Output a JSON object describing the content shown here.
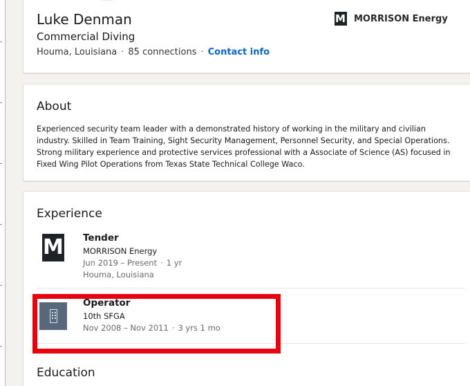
{
  "profile": {
    "name": "Luke Denman",
    "headline": "Commercial Diving",
    "location": "Houma, Louisiana",
    "connections": "85 connections",
    "contact_link": "Contact info",
    "current_company": {
      "name": "MORRISON Energy",
      "logo_letter": "M"
    }
  },
  "about": {
    "title": "About",
    "text": "Experienced security team leader with a demonstrated history of working in the military and civilian industry. Skilled in Team Training, Sight Security Management, Personnel Security, and Special Operations. Strong military experience and protective services professional with a Associate of Science (AS) focused in Fixed Wing Pilot Operations from Texas State Technical College Waco."
  },
  "experience": {
    "title": "Experience",
    "items": [
      {
        "role": "Tender",
        "company": "MORRISON Energy",
        "dates": "Jun 2019 – Present",
        "duration": "1 yr",
        "location": "Houma, Louisiana",
        "logo_letter": "M"
      },
      {
        "role": "Operator",
        "company": "10th SFGA",
        "dates": "Nov 2008 – Nov 2011",
        "duration": "3 yrs 1 mo",
        "logo": "building-icon"
      }
    ]
  },
  "education": {
    "title": "Education"
  },
  "colors": {
    "link": "#0a66c2",
    "highlight": "#e8000f",
    "logo_dark": "#1f2328",
    "logo_placeholder": "#56687a"
  }
}
